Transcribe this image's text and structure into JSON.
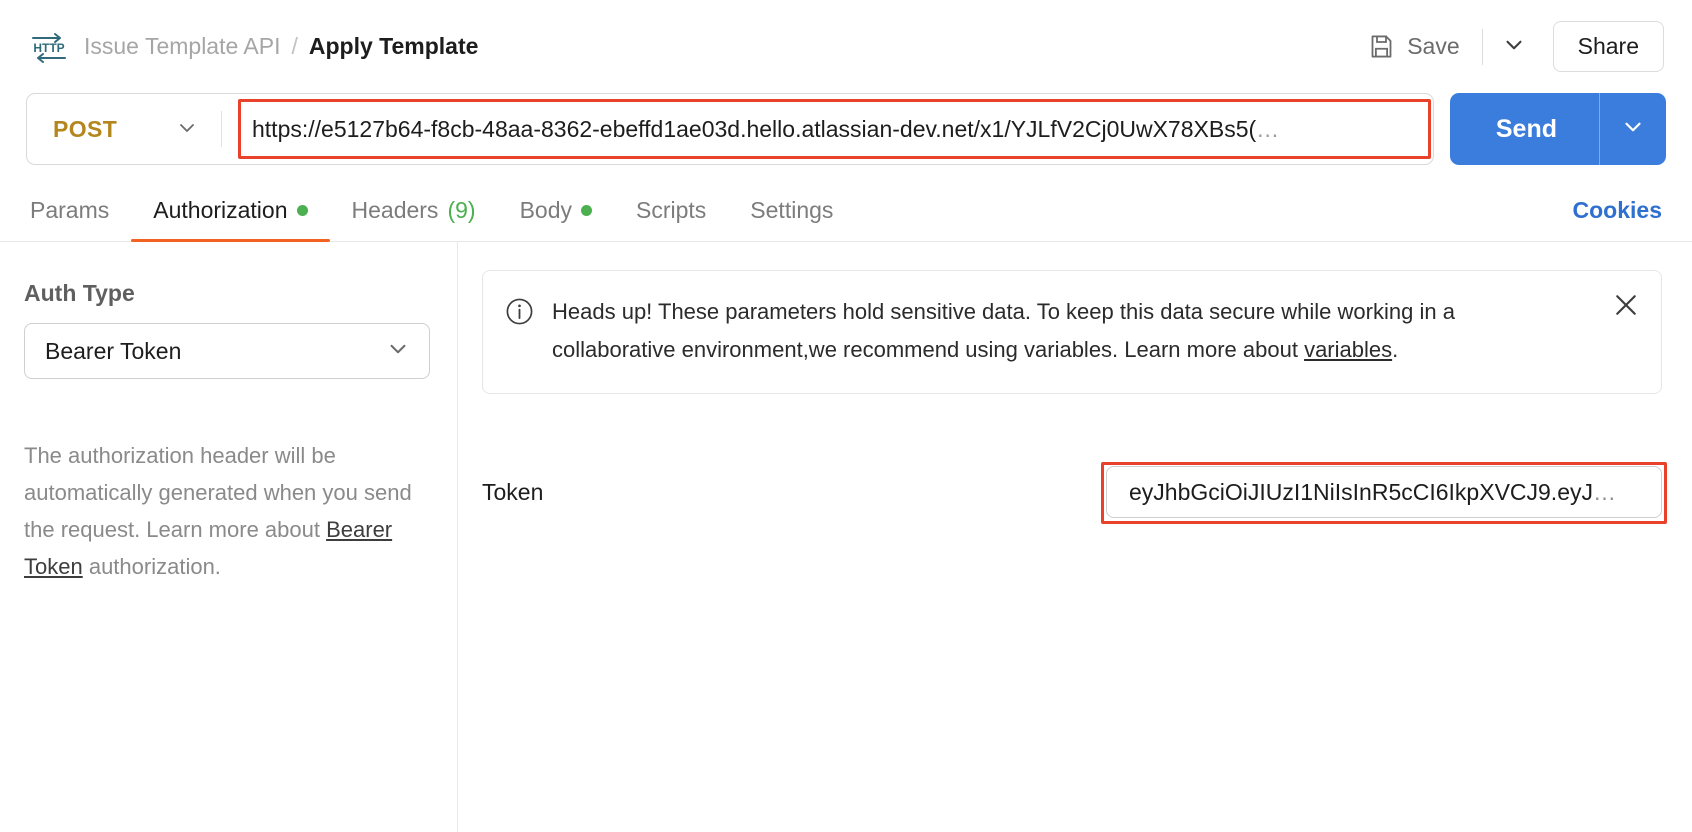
{
  "header": {
    "app_icon": "http-icon",
    "breadcrumb_parent": "Issue Template API",
    "breadcrumb_separator": "/",
    "breadcrumb_current": "Apply Template",
    "save_label": "Save",
    "save_icon": "floppy-disk-icon",
    "save_caret_icon": "chevron-down-icon",
    "share_label": "Share"
  },
  "request": {
    "method": "POST",
    "method_caret_icon": "chevron-down-icon",
    "url": "https://e5127b64-f8cb-48aa-8362-ebeffd1ae03d.hello.atlassian-dev.net/x1/YJLfV2Cj0UwX78XBs5(",
    "url_ellipsis": "…",
    "send_label": "Send",
    "send_caret_icon": "chevron-down-icon",
    "url_highlight_color": "#e8422a",
    "send_color": "#3b7ddd",
    "method_color": "#b3871e"
  },
  "tabs": {
    "items": [
      {
        "label": "Params",
        "active": false,
        "dot": false,
        "count": ""
      },
      {
        "label": "Authorization",
        "active": true,
        "dot": true,
        "count": ""
      },
      {
        "label": "Headers",
        "active": false,
        "dot": false,
        "count": "(9)"
      },
      {
        "label": "Body",
        "active": false,
        "dot": true,
        "count": ""
      },
      {
        "label": "Scripts",
        "active": false,
        "dot": false,
        "count": ""
      },
      {
        "label": "Settings",
        "active": false,
        "dot": false,
        "count": ""
      }
    ],
    "cookies_label": "Cookies",
    "active_underline_color": "#f26322",
    "dot_color": "#4caf50"
  },
  "auth_panel": {
    "auth_type_label": "Auth Type",
    "auth_type_value": "Bearer Token",
    "auth_type_caret_icon": "chevron-down-icon",
    "description_part1": "The authorization header will be automatically generated when you send the request. Learn more about ",
    "description_link": "Bearer Token",
    "description_part2": " authorization."
  },
  "notice": {
    "icon": "info-circle-icon",
    "text_part1": "Heads up! These parameters hold sensitive data. To keep this data secure while working in a collaborative environment,we recommend using variables. Learn more about ",
    "link": "variables",
    "text_part2": ".",
    "close_icon": "close-icon"
  },
  "token": {
    "label": "Token",
    "value": "eyJhbGciOiJIUzI1NiIsInR5cCI6IkpXVCJ9.eyJ",
    "ellipsis": "…",
    "highlight_color": "#e8422a"
  }
}
